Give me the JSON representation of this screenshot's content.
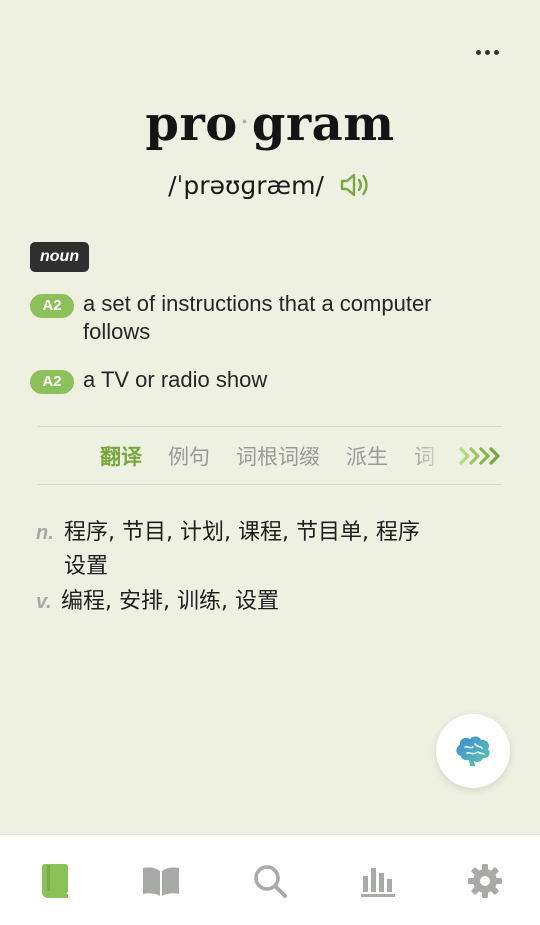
{
  "header": {
    "more_icon": "more-horizontal-icon"
  },
  "entry": {
    "syllables": [
      "pro",
      "gram"
    ],
    "separator": "·",
    "phonetic": "/ˈprəʊɡræm/",
    "audio_icon": "speaker-icon"
  },
  "part_of_speech": "noun",
  "definitions": [
    {
      "level": "A2",
      "text": "a set of instructions that a computer follows"
    },
    {
      "level": "A2",
      "text": "a TV or radio show"
    }
  ],
  "tabs": {
    "items": [
      "翻译",
      "例句",
      "词根词缀",
      "派生",
      "词"
    ],
    "active": "翻译",
    "next_icon": "triple-chevron-right-icon"
  },
  "translations": [
    {
      "pos": "n.",
      "text": "程序, 节目, 计划, 课程, 节目单, 程序设置"
    },
    {
      "pos": "v.",
      "text": "编程, 安排, 训练, 设置"
    }
  ],
  "fab": {
    "icon": "brain-icon"
  },
  "bottom_nav": {
    "items": [
      {
        "icon": "vocabulary-book-icon",
        "active": true
      },
      {
        "icon": "open-book-icon",
        "active": false
      },
      {
        "icon": "search-icon",
        "active": false
      },
      {
        "icon": "statistics-icon",
        "active": false
      },
      {
        "icon": "settings-gear-icon",
        "active": false
      }
    ]
  },
  "colors": {
    "accent": "#7aa63f",
    "level_badge": "#8cc15a",
    "background": "#eef1e1",
    "pos_badge": "#2f2f2f"
  }
}
